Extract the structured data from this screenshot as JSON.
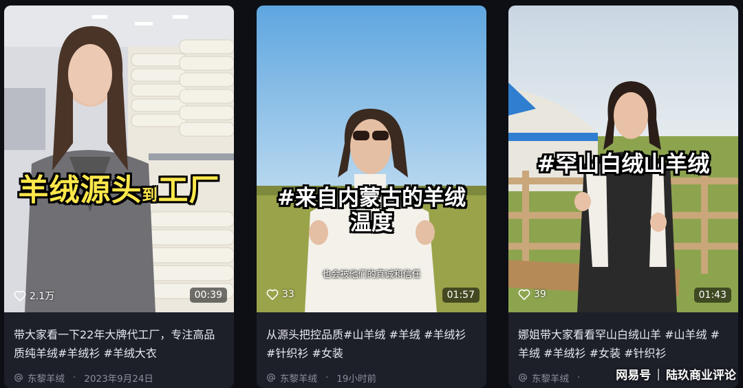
{
  "cards": [
    {
      "overlay_text": "羊绒源头",
      "overlay_small": "到",
      "overlay_end": "工厂",
      "likes": "2.1万",
      "duration": "00:39",
      "title": "带大家看一下22年大牌代工厂，专注高品质纯羊绒#羊绒衫 #羊绒大衣",
      "author": "东黎羊绒",
      "time": "2023年9月24日"
    },
    {
      "overlay_line1": "#来自内蒙古的羊绒",
      "overlay_line2": "温度",
      "subtitle": "也会被他们的真诚和信任",
      "likes": "33",
      "duration": "01:57",
      "title": "从源头把控品质#山羊绒 #羊绒 #羊绒衫 #针织衫 #女装",
      "author": "东黎羊绒",
      "time": "19小时前"
    },
    {
      "overlay_text": "#罕山白绒山羊绒",
      "likes": "39",
      "duration": "01:43",
      "title": "娜姐带大家看看罕山白绒山羊 #山羊绒 #羊绒 #羊绒衫 #女装 #针织衫",
      "author": "东黎羊绒",
      "time": ""
    }
  ],
  "watermark": {
    "left": "网易号",
    "separator": "|",
    "right": "陆玖商业评论"
  },
  "colors": {
    "background": "#0d0f15",
    "card": "#1d2029",
    "overlay_yellow": "#ffe84a"
  }
}
